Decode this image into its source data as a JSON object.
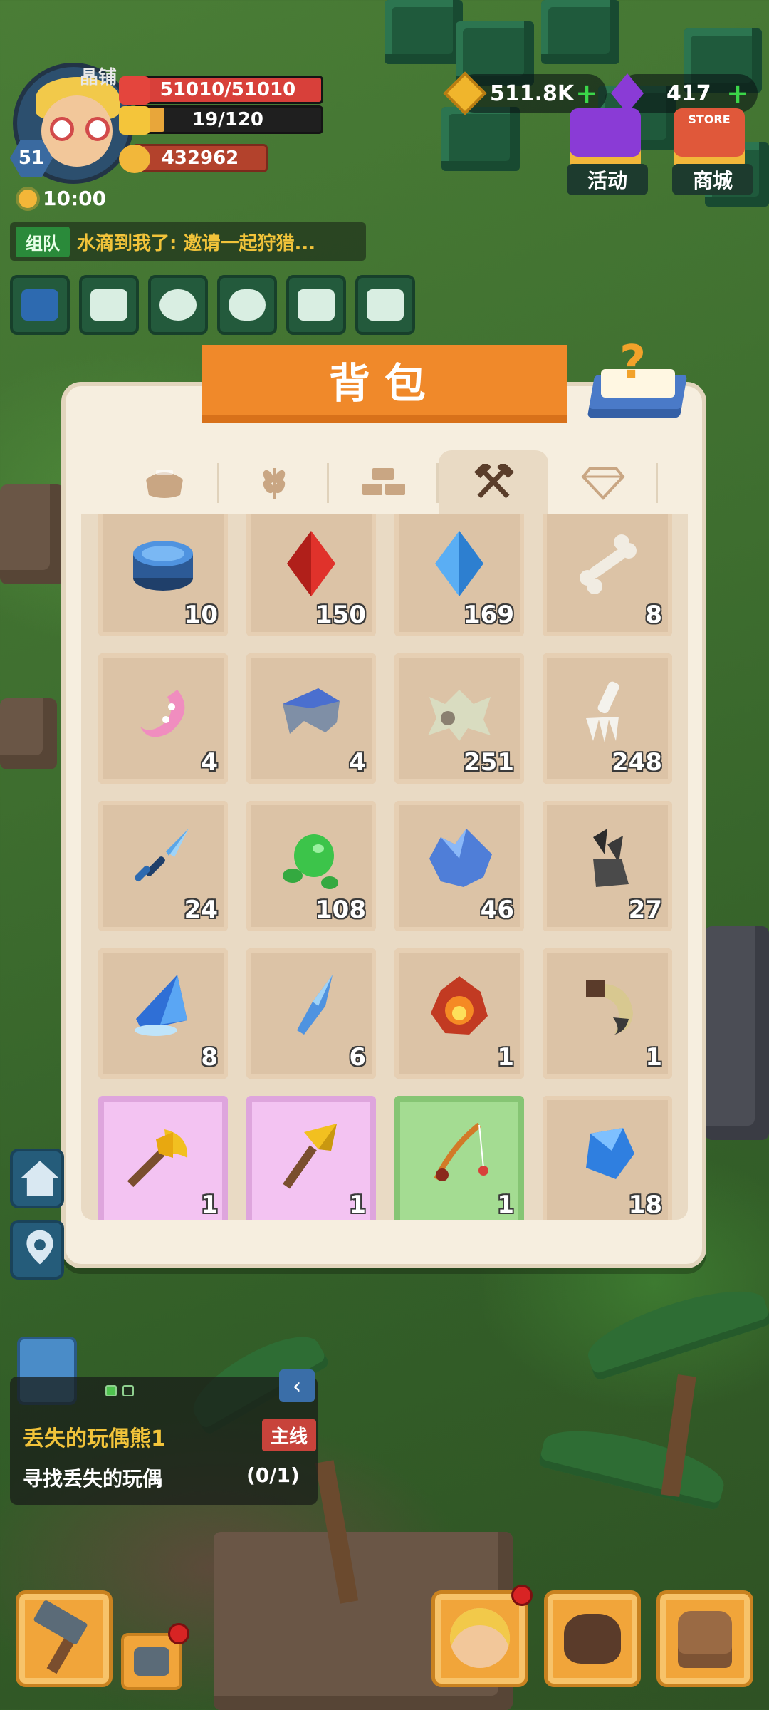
{
  "hud": {
    "level": "51",
    "name_fragment": "晶铺",
    "hp": "51010/51010",
    "stamina": "19/120",
    "coins": "432962",
    "time": "10:00"
  },
  "currency": {
    "gold": "511.8K",
    "gems": "417"
  },
  "top_buttons": {
    "event_label": "活动",
    "shop_label": "商城",
    "shop_sign": "STORE"
  },
  "chat": {
    "channel": "组队",
    "message": "水滴到我了: 邀请一起狩猎..."
  },
  "quick_icons": [
    "grid-icon",
    "mail-icon",
    "friends-icon",
    "chat-icon",
    "map-icon",
    "card-icon"
  ],
  "backpack": {
    "title": "背包",
    "tabs": [
      {
        "icon": "basket-icon",
        "active": false
      },
      {
        "icon": "wheat-icon",
        "active": false
      },
      {
        "icon": "bricks-icon",
        "active": false
      },
      {
        "icon": "tools-icon",
        "active": true
      },
      {
        "icon": "diamond-icon",
        "active": false
      }
    ],
    "items": [
      {
        "icon": "blue-drum-icon",
        "qty": "10",
        "rarity": "normal"
      },
      {
        "icon": "red-crystal-icon",
        "qty": "150",
        "rarity": "normal"
      },
      {
        "icon": "blue-crystal-icon",
        "qty": "169",
        "rarity": "normal"
      },
      {
        "icon": "bone-icon",
        "qty": "8",
        "rarity": "normal"
      },
      {
        "icon": "tentacle-icon",
        "qty": "4",
        "rarity": "normal"
      },
      {
        "icon": "shell-icon",
        "qty": "4",
        "rarity": "normal"
      },
      {
        "icon": "fur-pelt-icon",
        "qty": "251",
        "rarity": "normal"
      },
      {
        "icon": "claw-bone-icon",
        "qty": "248",
        "rarity": "normal"
      },
      {
        "icon": "ice-dagger-icon",
        "qty": "24",
        "rarity": "normal"
      },
      {
        "icon": "slime-icon",
        "qty": "108",
        "rarity": "normal"
      },
      {
        "icon": "ice-ore-icon",
        "qty": "46",
        "rarity": "normal"
      },
      {
        "icon": "dark-claw-icon",
        "qty": "27",
        "rarity": "normal"
      },
      {
        "icon": "ice-shard-icon",
        "qty": "8",
        "rarity": "normal"
      },
      {
        "icon": "ice-blade-icon",
        "qty": "6",
        "rarity": "normal"
      },
      {
        "icon": "fire-core-icon",
        "qty": "1",
        "rarity": "normal"
      },
      {
        "icon": "horn-icon",
        "qty": "1",
        "rarity": "normal"
      },
      {
        "icon": "golden-axe-icon",
        "qty": "1",
        "rarity": "purple"
      },
      {
        "icon": "golden-pickaxe-icon",
        "qty": "1",
        "rarity": "purple"
      },
      {
        "icon": "fishing-rod-icon",
        "qty": "1",
        "rarity": "green"
      },
      {
        "icon": "sapphire-icon",
        "qty": "18",
        "rarity": "normal"
      }
    ]
  },
  "quest": {
    "title": "丢失的玩偶熊1",
    "tag": "主线",
    "description": "寻找丢失的玩偶",
    "progress": "(0/1)"
  },
  "colors": {
    "panel_bg": "#f6eedf",
    "title_orange": "#f0892a",
    "hp_red": "#d8403a",
    "quest_yellow": "#f1c33a"
  }
}
